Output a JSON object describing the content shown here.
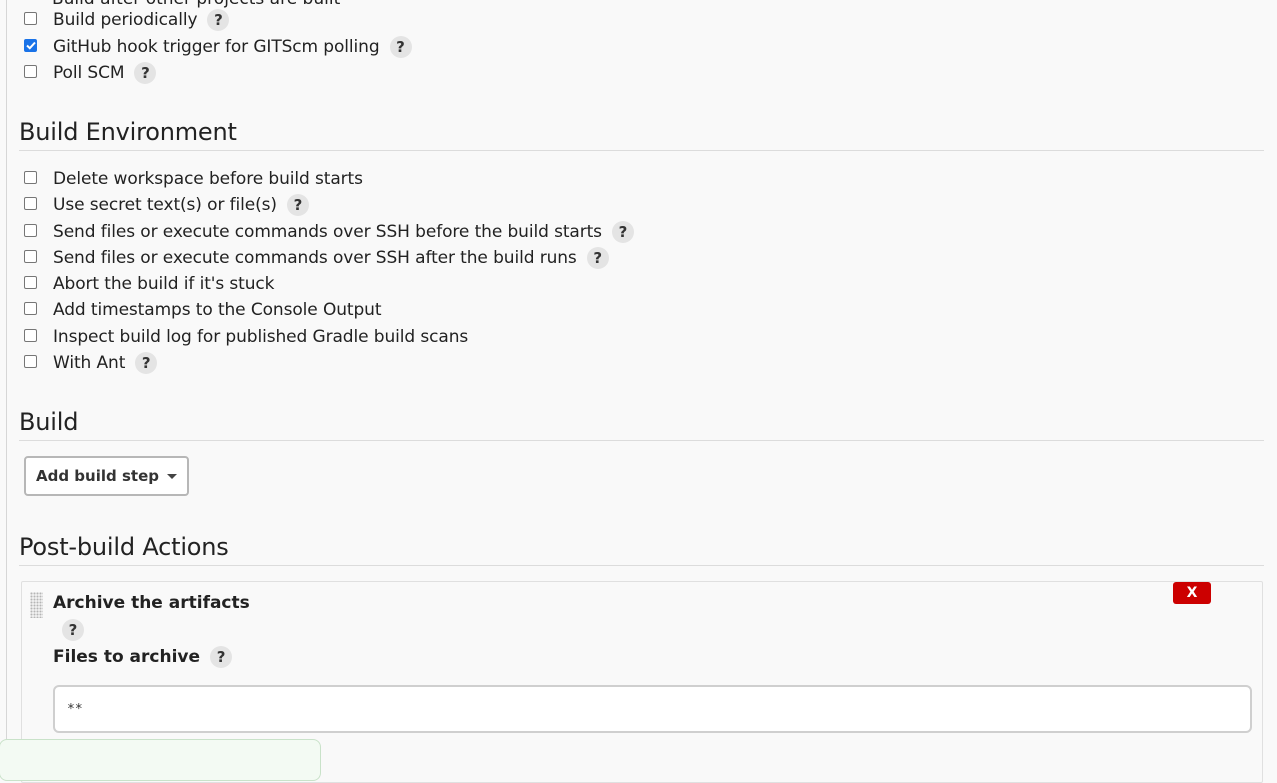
{
  "build_triggers": {
    "partial_item": "Build after other projects are built",
    "items": [
      {
        "label": "Build periodically",
        "checked": false,
        "help": "?"
      },
      {
        "label": "GitHub hook trigger for GITScm polling",
        "checked": true,
        "help": "?"
      },
      {
        "label": "Poll SCM",
        "checked": false,
        "help": "?"
      }
    ]
  },
  "build_environment": {
    "title": "Build Environment",
    "items": [
      {
        "label": "Delete workspace before build starts",
        "checked": false
      },
      {
        "label": "Use secret text(s) or file(s)",
        "checked": false,
        "help": "?"
      },
      {
        "label": "Send files or execute commands over SSH before the build starts",
        "checked": false,
        "help": "?"
      },
      {
        "label": "Send files or execute commands over SSH after the build runs",
        "checked": false,
        "help": "?"
      },
      {
        "label": "Abort the build if it's stuck",
        "checked": false
      },
      {
        "label": "Add timestamps to the Console Output",
        "checked": false
      },
      {
        "label": "Inspect build log for published Gradle build scans",
        "checked": false
      },
      {
        "label": "With Ant",
        "checked": false,
        "help": "?"
      }
    ]
  },
  "build": {
    "title": "Build",
    "add_step_label": "Add build step"
  },
  "post_build": {
    "title": "Post-build Actions",
    "archive": {
      "title": "Archive the artifacts",
      "help": "?",
      "close_label": "X",
      "files_label": "Files to archive",
      "files_help": "?",
      "files_value": "**"
    }
  },
  "colors": {
    "checkbox_checked": "#1a73e8",
    "close_button": "#cc0000"
  }
}
